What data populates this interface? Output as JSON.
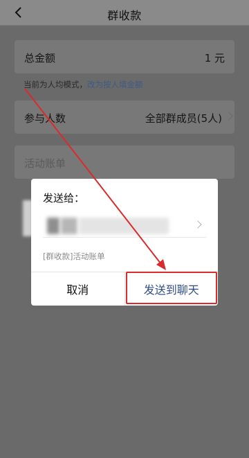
{
  "header": {
    "title": "群收款"
  },
  "total": {
    "label": "总金额",
    "value": "1 元"
  },
  "hint": {
    "prefix": "当前为人均模式，",
    "link": "改为按人填金额"
  },
  "participants": {
    "label": "参与人数",
    "value": "全部群成员(5人)"
  },
  "activity": {
    "placeholder": "活动账单"
  },
  "dialog": {
    "title": "发送给：",
    "subtitle": "[群收款]活动账单",
    "cancel_label": "取消",
    "send_label": "发送到聊天"
  },
  "colors": {
    "annotation": "#d92b2b",
    "link": "#3f5a85"
  }
}
